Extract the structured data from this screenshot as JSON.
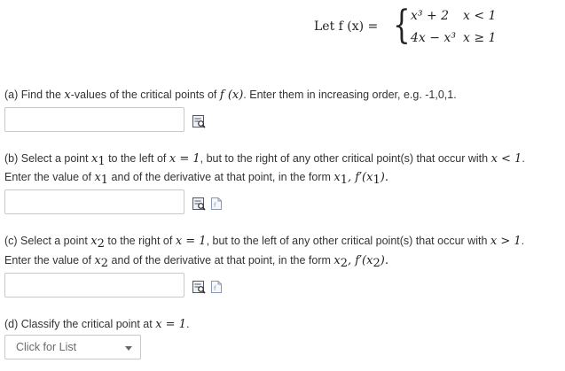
{
  "function_def": {
    "lead": "Let f (x) =",
    "case1_expr": "x³ + 2",
    "case1_cond": "x < 1",
    "case2_expr": "4x − x³",
    "case2_cond": "x ≥ 1"
  },
  "part_a": {
    "text_prefix": "(a) Find the ",
    "var": "x",
    "text_mid": "-values of the critical points of ",
    "fx": "f (x)",
    "text_suffix": ". Enter them in increasing order, e.g. -1,0,1.",
    "answer_value": ""
  },
  "part_b": {
    "line1_prefix": "(b) Select a point ",
    "line1_var": "x",
    "line1_sub": "1",
    "line1_mid": " to the left of ",
    "line1_eq": "x = 1",
    "line1_mid2": ", but to the right of any other critical point(s) that occur with ",
    "line1_ineq": "x < 1",
    "line1_end": ".",
    "line2_prefix": "Enter the value of ",
    "line2_var": "x",
    "line2_sub": "1",
    "line2_mid": " and of the derivative at that point, in the form ",
    "line2_form": "x",
    "line2_form_sub": "1",
    "line2_form_rest": ", f′(x",
    "line2_form_sub2": "1",
    "line2_form_close": ").",
    "answer_value": ""
  },
  "part_c": {
    "line1_prefix": "(c) Select a point ",
    "line1_var": "x",
    "line1_sub": "2",
    "line1_mid": " to the right of ",
    "line1_eq": "x = 1",
    "line1_mid2": ", but to the left of any other critical point(s) that occur with ",
    "line1_ineq": "x > 1",
    "line1_end": ".",
    "line2_prefix": "Enter the value of ",
    "line2_var": "x",
    "line2_sub": "2",
    "line2_mid": " and of the derivative at that point, in the form ",
    "line2_form": "x",
    "line2_form_sub": "2",
    "line2_form_rest": ", f′(x",
    "line2_form_sub2": "2",
    "line2_form_close": ").",
    "answer_value": ""
  },
  "part_d": {
    "text_prefix": "(d) Classify the critical point at ",
    "eq": "x = 1",
    "text_end": ".",
    "select_placeholder": "Click for List"
  },
  "icons": {
    "preview": "preview-icon",
    "help": "help-icon"
  }
}
